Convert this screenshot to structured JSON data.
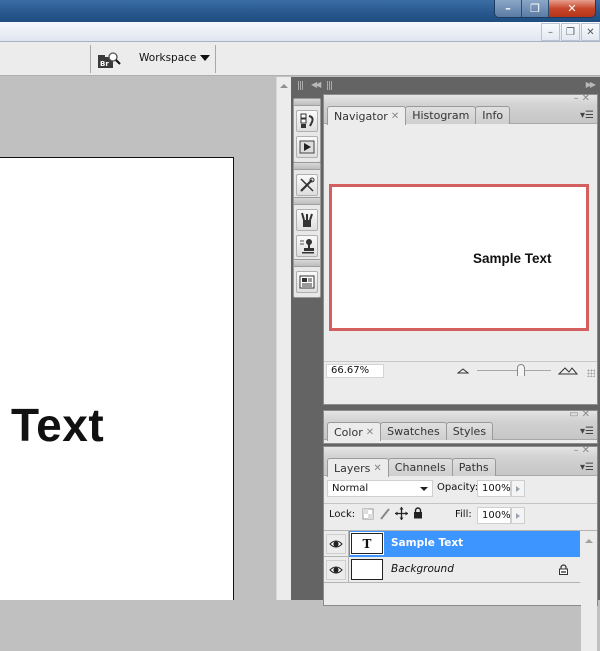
{
  "window": {
    "controls": {
      "minimize": "–",
      "maximize": "❐",
      "close": "✕"
    },
    "mdi_controls": {
      "minimize": "–",
      "restore": "🗗",
      "close": "✕"
    }
  },
  "options_bar": {
    "bridge_icon": "bridge-search-icon",
    "workspace_label": "Workspace"
  },
  "document": {
    "visible_text": "Text"
  },
  "panels": {
    "navigator": {
      "tabs": [
        {
          "label": "Navigator",
          "active": true,
          "closable": true
        },
        {
          "label": "Histogram",
          "active": false
        },
        {
          "label": "Info",
          "active": false
        }
      ],
      "preview_text": "Sample Text",
      "zoom_value": "66.67%",
      "zoom_slider_percent": 60,
      "viewport_color": "#d35f5f"
    },
    "color": {
      "tabs": [
        {
          "label": "Color",
          "active": true,
          "closable": true
        },
        {
          "label": "Swatches",
          "active": false
        },
        {
          "label": "Styles",
          "active": false
        }
      ]
    },
    "layers": {
      "tabs": [
        {
          "label": "Layers",
          "active": true,
          "closable": true
        },
        {
          "label": "Channels",
          "active": false
        },
        {
          "label": "Paths",
          "active": false
        }
      ],
      "blend_mode": "Normal",
      "opacity_label": "Opacity:",
      "opacity_value": "100%",
      "lock_label": "Lock:",
      "fill_label": "Fill:",
      "fill_value": "100%",
      "items": [
        {
          "name": "Sample Text",
          "thumb": "T",
          "selected": true,
          "visible": true,
          "locked": false
        },
        {
          "name": "Background",
          "thumb": "",
          "selected": false,
          "visible": true,
          "locked": true
        }
      ]
    }
  },
  "colors": {
    "selection": "#3d95ff",
    "dock_bg": "#646464",
    "canvas_bg": "#c0c0c0"
  }
}
